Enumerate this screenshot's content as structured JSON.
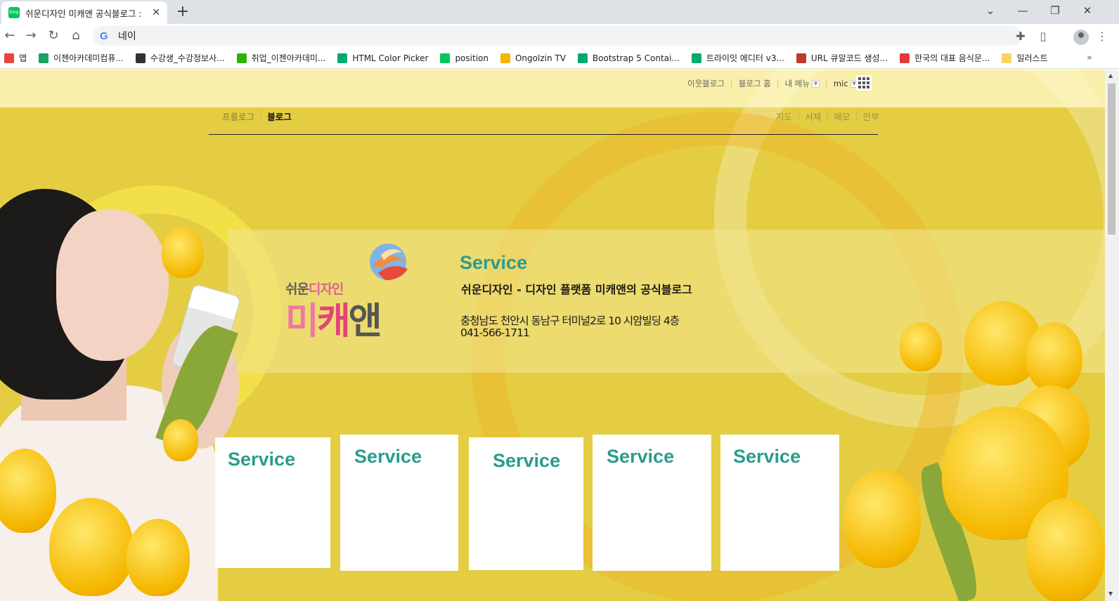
{
  "browser": {
    "tab_title": "쉬운디자인 미캐앤 공식블로그 :",
    "tab_favicon_text": "blog",
    "new_tab": "+",
    "address": "네이",
    "bookmarks": [
      {
        "label": "앱",
        "icon": "apps-grid-icon",
        "color": "#e8453c"
      },
      {
        "label": "이젠아카데미컴퓨...",
        "icon": "ezen-icon",
        "color": "#1aa260"
      },
      {
        "label": "수강생_수강정보사...",
        "icon": "globe-icon",
        "color": "#333333"
      },
      {
        "label": "취업_이젠아카데미...",
        "icon": "ezen-job-icon",
        "color": "#2db400"
      },
      {
        "label": "HTML Color Picker",
        "icon": "w3-icon",
        "color": "#04aa6d"
      },
      {
        "label": "position",
        "icon": "naver-icon",
        "color": "#03c75a"
      },
      {
        "label": "Ongolzin TV",
        "icon": "ongolzin-icon",
        "color": "#f4b400"
      },
      {
        "label": "Bootstrap 5 Contai...",
        "icon": "w3-icon",
        "color": "#04aa6d"
      },
      {
        "label": "트라이잇 에디터 v3...",
        "icon": "w3-icon",
        "color": "#04aa6d"
      },
      {
        "label": "URL 큐알코드 생성...",
        "icon": "qr-icon",
        "color": "#c0392b"
      },
      {
        "label": "한국의 대표 음식문...",
        "icon": "food-site-icon",
        "color": "#e53935"
      },
      {
        "label": "일러스트",
        "icon": "folder-icon",
        "color": "#f6d365"
      }
    ],
    "bookmarks_more": "»"
  },
  "blog": {
    "top_menu": {
      "neighbor": "이웃블로그",
      "home": "블로그 홈",
      "my_menu": "내 메뉴",
      "user": "mic"
    },
    "subnav_left": {
      "prologue": "프롤로그",
      "blog": "블로그"
    },
    "subnav_right": [
      "지도",
      "서재",
      "메모",
      "안부"
    ],
    "banner": {
      "logo_small_1": "쉬운",
      "logo_small_2": "디자인",
      "logo_big_1": "미",
      "logo_big_2": "캐",
      "logo_big_3": "앤",
      "title": "Service",
      "subtitle": "쉬운디자인 - 디자인 플랫폼 미캐앤의 공식블로그",
      "address": "충청남도 천안시 동남구 터미널2로 10 시암빌딩 4층",
      "phone": "041-566-1711"
    },
    "cards": [
      {
        "title": "Service"
      },
      {
        "title": "Service"
      },
      {
        "title": "Service"
      },
      {
        "title": "Service"
      },
      {
        "title": "Service"
      }
    ]
  },
  "colors": {
    "page_bg": "#e4cd42",
    "accent_teal": "#2a9c8c",
    "card_bg": "#ffffff"
  }
}
